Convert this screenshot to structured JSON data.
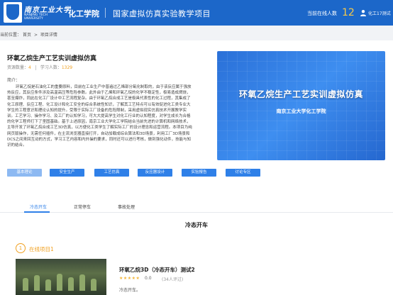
{
  "header": {
    "logo_cn": "南京工业大学",
    "logo_en": "NANJING TECH UNIVERSITY",
    "college": "化工学院",
    "site_title": "国家虚拟仿真实验教学项目",
    "online_label": "当前在线人数",
    "online_count": "12",
    "user_name": "化工17测试"
  },
  "breadcrumb": {
    "prefix": "当前位置：",
    "home": "首页",
    "separator": ">",
    "current": "项目详情"
  },
  "course": {
    "title": "环氧乙烷生产工艺实训虚拟仿真",
    "resources_label": "资源数量：",
    "resources_value": "4",
    "learners_label": "学习人数：",
    "learners_value": "1329",
    "intro_label": "简介：",
    "intro_text": "环氧乙烷是石油化工的重要原料，目前在工业生产中普遍过乙烯部分氧化制取的，由于该反应属于强放热反应，其反应条件涉及高温高压等危险参数。此外由于乙烯和环氧乙烷的化学不稳定性，极易造成燃烧，甚至爆炸，同此在化工厂设计中工艺流程复杂。由于环氧乙烷合成工艺是极具代表性的化工过程，其集成了化工原理、反应工程、化工设计和化工安全的综合系统性知识，了解其工艺特点可以有效促进化工类专业大学生的工程意识和理论认知的提升。受限于实际工厂设备的危险限制，采用虚拟现实仿真技术开展教学实训。工艺学习、操作学习、及工厂的认知学习，可大大提高学生对化工行业的认知程度，对学生成长为合格的化学工程师打下了坚固基础。基于上述原因，南京工业大学化工学院结合当前先进的计算机和网络技术，主导开发了环氧乙烷合成工艺3D仿真，以方便化工类学生了解实际工厂的设计理念和运营流程。本项目为纯网页版操作，无需任何插件，在主流浏览器直接打开，自动加载成综合算法和3D场景，利用工厂3D场景和DCS之间来回互动的方式，学习工艺内容和内外操的要求，同时还可以进行考核，做到强化动件，技能与知识的结合。",
    "banner_title": "环氧乙烷生产工艺实训虚拟仿真",
    "banner_subtitle": "南京工业大学化工学院",
    "buttons": [
      "基本理论",
      "安全生产",
      "工艺仿真",
      "反应器设计",
      "实验报告",
      "讨论专区"
    ]
  },
  "tabs": [
    "冷态开车",
    "正常停车",
    "事故处理"
  ],
  "section_title": "冷态开车",
  "project": {
    "index": "1",
    "label": "在线项目1",
    "name": "环氧乙烷3D（冷态开车）测试2",
    "stars": "★★★★★",
    "score": "0.0",
    "reviews": "(34人评过)",
    "desc": "冷态开车。"
  },
  "colors": {
    "brand_blue": "#1c67c9",
    "accent_blue": "#2f80e8",
    "accent_orange": "#f0a020"
  },
  "icons": [
    "logo-emblem",
    "user-icon"
  ]
}
